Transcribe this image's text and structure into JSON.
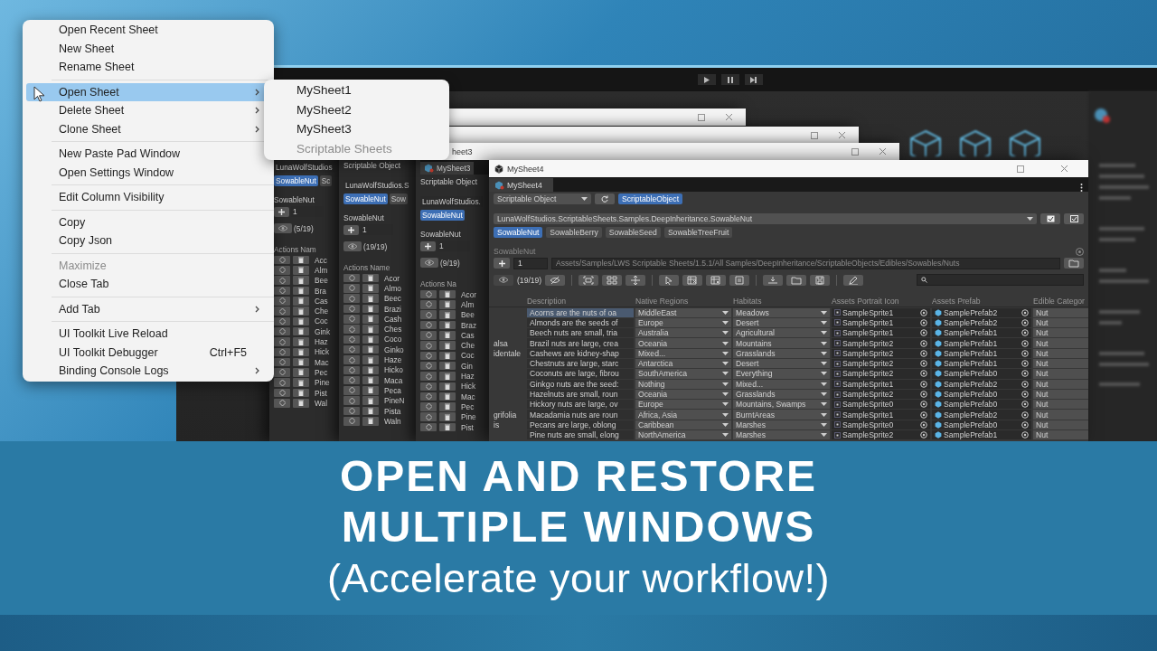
{
  "menu": {
    "sections": [
      [
        {
          "label": "Open Recent Sheet",
          "selected": false,
          "disabled": false,
          "submenu": false
        },
        {
          "label": "New Sheet",
          "selected": false,
          "disabled": false,
          "submenu": false
        },
        {
          "label": "Rename Sheet",
          "selected": false,
          "disabled": false,
          "submenu": false
        }
      ],
      [
        {
          "label": "Open Sheet",
          "selected": true,
          "disabled": false,
          "submenu": true
        },
        {
          "label": "Delete Sheet",
          "selected": false,
          "disabled": false,
          "submenu": true
        },
        {
          "label": "Clone Sheet",
          "selected": false,
          "disabled": false,
          "submenu": true
        }
      ],
      [
        {
          "label": "New Paste Pad Window",
          "selected": false,
          "disabled": false,
          "submenu": false
        },
        {
          "label": "Open Settings Window",
          "selected": false,
          "disabled": false,
          "submenu": false
        }
      ],
      [
        {
          "label": "Edit Column Visibility",
          "selected": false,
          "disabled": false,
          "submenu": false
        }
      ],
      [
        {
          "label": "Copy",
          "selected": false,
          "disabled": false,
          "submenu": false
        },
        {
          "label": "Copy Json",
          "selected": false,
          "disabled": false,
          "submenu": false
        }
      ],
      [
        {
          "label": "Maximize",
          "selected": false,
          "disabled": true,
          "submenu": false
        },
        {
          "label": "Close Tab",
          "selected": false,
          "disabled": false,
          "submenu": false
        }
      ],
      [
        {
          "label": "Add Tab",
          "selected": false,
          "disabled": false,
          "submenu": true
        }
      ],
      [
        {
          "label": "UI Toolkit Live Reload",
          "selected": false,
          "disabled": false,
          "submenu": false
        },
        {
          "label": "UI Toolkit Debugger",
          "selected": false,
          "disabled": false,
          "submenu": false,
          "shortcut": "Ctrl+F5"
        },
        {
          "label": "Binding Console Logs",
          "selected": false,
          "disabled": false,
          "submenu": true
        }
      ]
    ]
  },
  "submenu": {
    "items": [
      {
        "label": "MySheet1",
        "disabled": false
      },
      {
        "label": "MySheet2",
        "disabled": false
      },
      {
        "label": "MySheet3",
        "disabled": false
      },
      {
        "label": "Scriptable Sheets",
        "disabled": true
      }
    ]
  },
  "background_windows": [
    {
      "type_field": "LunaWolfStudios",
      "chips": [
        {
          "label": "SowableNut",
          "selected": true
        },
        {
          "label": "Sc",
          "selected": false
        }
      ],
      "section": "SowableNut",
      "count_field": "1",
      "filter_count": "(5/19)",
      "headers": [
        "Actions",
        "Nam"
      ],
      "rows": [
        "Acc",
        "Alm",
        "Bee",
        "Bra",
        "Cas",
        "Che",
        "Coc",
        "Gink",
        "Haz",
        "Hick",
        "Mac",
        "Pec",
        "Pine",
        "Pist",
        "Wal"
      ]
    },
    {
      "object_dropdown": "Scriptable Object",
      "type_field": "LunaWolfStudios.S",
      "chips": [
        {
          "label": "SowableNut",
          "selected": true
        },
        {
          "label": "Sow",
          "selected": false
        }
      ],
      "section": "SowableNut",
      "count_field": "1",
      "filter_count": "(19/19)",
      "headers": [
        "Actions",
        "Name"
      ],
      "rows": [
        "Acor",
        "Almo",
        "Beec",
        "Brazi",
        "Cash",
        "Ches",
        "Coco",
        "Ginko",
        "Haze",
        "Hicko",
        "Maca",
        "Peca",
        "PineN",
        "Pista",
        "Waln"
      ]
    },
    {
      "title": "heet3",
      "tab": "MySheet3",
      "object_dropdown": "Scriptable Object",
      "type_field": "LunaWolfStudios.",
      "chips": [
        {
          "label": "SowableNut",
          "selected": true
        }
      ],
      "section": "SowableNut",
      "count_field": "1",
      "filter_count": "(9/19)",
      "headers": [
        "Actions",
        "Na"
      ],
      "rows": [
        "Acor",
        "Alm",
        "Bee",
        "Braz",
        "Cas",
        "Che",
        "Coc",
        "Gin",
        "Haz",
        "Hick",
        "Mac",
        "Pec",
        "Pine",
        "Pist"
      ]
    }
  ],
  "main_window": {
    "title": "MySheet4",
    "tab": "MySheet4",
    "object_dropdown": "Scriptable Object",
    "object_chips": [
      {
        "label": "ScriptableObject",
        "selected": true
      }
    ],
    "type_dropdown": "LunaWolfStudios.ScriptableSheets.Samples.DeepInheritance.SowableNut",
    "type_chips": [
      {
        "label": "SowableNut",
        "selected": true
      },
      {
        "label": "SowableBerry",
        "selected": false
      },
      {
        "label": "SowableSeed",
        "selected": false
      },
      {
        "label": "SowableTreeFruit",
        "selected": false
      }
    ],
    "section": "SowableNut",
    "count_field": "1",
    "path": "Assets/Samples/LWS Scriptable Sheets/1.5.1/All Samples/DeepInheritance/ScriptableObjects/Edibles/Sowables/Nuts",
    "filter_count": "(19/19)",
    "columns": [
      "Description",
      "Native Regions",
      "Habitats",
      "Assets Portrait Icon",
      "Assets Prefab",
      "Edible Categor"
    ],
    "rows": [
      {
        "selected": true,
        "description": "Acorns are the nuts of oa",
        "native_regions": "MiddleEast",
        "habitats": "Meadows",
        "portrait_icon": "SampleSprite1",
        "prefab": "SamplePrefab2",
        "edible_category": "Nut"
      },
      {
        "selected": false,
        "description": "Almonds are the seeds of",
        "native_regions": "Europe",
        "habitats": "Desert",
        "portrait_icon": "SampleSprite1",
        "prefab": "SamplePrefab2",
        "edible_category": "Nut"
      },
      {
        "selected": false,
        "description": "Beech nuts are small, tria",
        "native_regions": "Australia",
        "habitats": "Agricultural",
        "portrait_icon": "SampleSprite1",
        "prefab": "SamplePrefab1",
        "edible_category": "Nut"
      },
      {
        "selected": false,
        "column_1": "alsa",
        "description": "Brazil nuts are large, crea",
        "native_regions": "Oceania",
        "habitats": "Mountains",
        "portrait_icon": "SampleSprite2",
        "prefab": "SamplePrefab1",
        "edible_category": "Nut"
      },
      {
        "selected": false,
        "column_1": "identale",
        "description": "Cashews are kidney-shap",
        "native_regions": "Mixed...",
        "habitats": "Grasslands",
        "portrait_icon": "SampleSprite2",
        "prefab": "SamplePrefab1",
        "edible_category": "Nut"
      },
      {
        "selected": false,
        "description": "Chestnuts are large, starc",
        "native_regions": "Antarctica",
        "habitats": "Desert",
        "portrait_icon": "SampleSprite2",
        "prefab": "SamplePrefab1",
        "edible_category": "Nut"
      },
      {
        "selected": false,
        "description": "Coconuts are large, fibrou",
        "native_regions": "SouthAmerica",
        "habitats": "Everything",
        "portrait_icon": "SampleSprite2",
        "prefab": "SamplePrefab0",
        "edible_category": "Nut"
      },
      {
        "selected": false,
        "description": "Ginkgo nuts are the seed:",
        "native_regions": "Nothing",
        "habitats": "Mixed...",
        "portrait_icon": "SampleSprite1",
        "prefab": "SamplePrefab2",
        "edible_category": "Nut"
      },
      {
        "selected": false,
        "description": "Hazelnuts are small, roun",
        "native_regions": "Oceania",
        "habitats": "Grasslands",
        "portrait_icon": "SampleSprite2",
        "prefab": "SamplePrefab0",
        "edible_category": "Nut"
      },
      {
        "selected": false,
        "description": "Hickory nuts are large, ov",
        "native_regions": "Europe",
        "habitats": "Mountains, Swamps",
        "portrait_icon": "SampleSprite0",
        "prefab": "SamplePrefab0",
        "edible_category": "Nut"
      },
      {
        "selected": false,
        "column_1": "grifolia",
        "description": "Macadamia nuts are roun",
        "native_regions": "Africa, Asia",
        "habitats": "BurntAreas",
        "portrait_icon": "SampleSprite1",
        "prefab": "SamplePrefab2",
        "edible_category": "Nut"
      },
      {
        "selected": false,
        "column_1": "is",
        "description": "Pecans are large, oblong",
        "native_regions": "Caribbean",
        "habitats": "Marshes",
        "portrait_icon": "SampleSprite0",
        "prefab": "SamplePrefab0",
        "edible_category": "Nut"
      },
      {
        "selected": false,
        "description": "Pine nuts are small, elong",
        "native_regions": "NorthAmerica",
        "habitats": "Marshes",
        "portrait_icon": "SampleSprite2",
        "prefab": "SamplePrefab1",
        "edible_category": "Nut"
      }
    ]
  },
  "banner": {
    "title_lines": [
      "OPEN AND RESTORE",
      "MULTIPLE WINDOWS"
    ],
    "subtitle": "(Accelerate your workflow!)"
  }
}
